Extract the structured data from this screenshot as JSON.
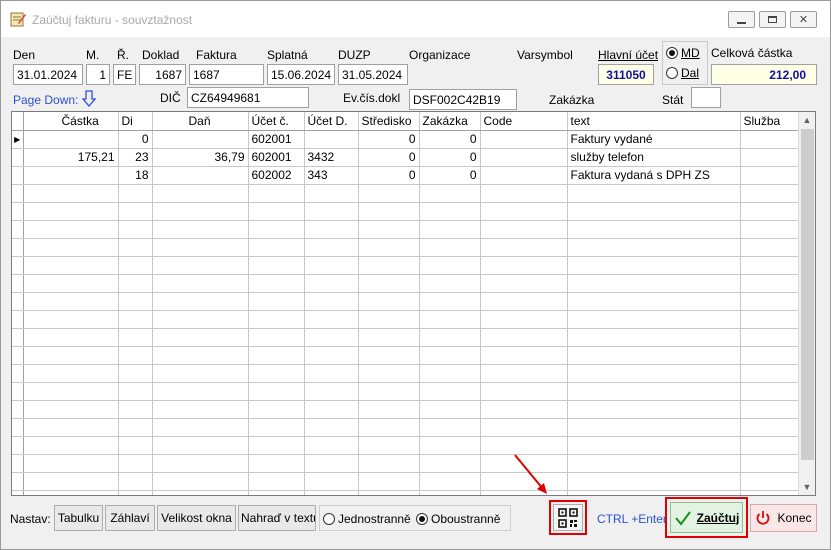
{
  "window": {
    "title": "Zaúčtuj fakturu - souvztažnost"
  },
  "header": {
    "labels": {
      "den": "Den",
      "m": "M.",
      "r": "Ř.",
      "doklad": "Doklad",
      "faktura": "Faktura",
      "splatna": "Splatná",
      "duzp": "DUZP",
      "organizace": "Organizace",
      "varsymbol": "Varsymbol",
      "hlavni_ucet": "Hlavní účet",
      "celkova_castka": "Celková částka",
      "dic": "DIČ",
      "ev_cis": "Ev.čís.dokl",
      "zakazka": "Zakázka",
      "stat": "Stát",
      "page_down": "Page Down:"
    },
    "values": {
      "den": "31.01.2024",
      "m": "1",
      "r": "FE",
      "doklad": "1687",
      "faktura": "1687",
      "splatna": "15.06.2024",
      "duzp": "31.05.2024",
      "organizace": "",
      "varsymbol": "",
      "hlavni_ucet": "311050",
      "celkova_castka": "212,00",
      "dic": "CZ64949681",
      "ev_cis": "DSF002C42B19",
      "zakazka": "",
      "stat": ""
    },
    "side": {
      "md": "MD",
      "dal": "Dal",
      "selected": "MD"
    }
  },
  "grid": {
    "columns": [
      "",
      "Částka",
      "Di",
      "Daň",
      "Účet č.",
      "Účet D.",
      "Středisko",
      "Zakázka",
      "Code",
      "text",
      "Služba"
    ],
    "rows": [
      [
        "",
        "0",
        "",
        "602001",
        "",
        "0",
        "0",
        "",
        "Faktury vydané",
        ""
      ],
      [
        "175,21",
        "23",
        "36,79",
        "602001",
        "3432",
        "0",
        "0",
        "",
        "služby telefon",
        ""
      ],
      [
        "",
        "18",
        "",
        "602002",
        "343",
        "0",
        "0",
        "",
        "Faktura vydaná s DPH ZS",
        ""
      ]
    ],
    "empty_rows": 18
  },
  "footer": {
    "nastav": "Nastav:",
    "tabulku": "Tabulku",
    "zahlavi": "Záhlaví",
    "velikost_okna": "Velikost okna",
    "nahrad_v_textu": "Nahraď v textu",
    "jednostranne": "Jednostranně",
    "oboustranne": "Oboustranně",
    "print_mode_selected": "Oboustranně",
    "ctrl_enter": "CTRL +Enter",
    "zauctuj": "Zaúčtuj",
    "konec": "Konec"
  },
  "colors": {
    "accent_blue": "#2a52d0",
    "highlight_red": "#e00000",
    "field_yellow": "#ffffe6"
  }
}
